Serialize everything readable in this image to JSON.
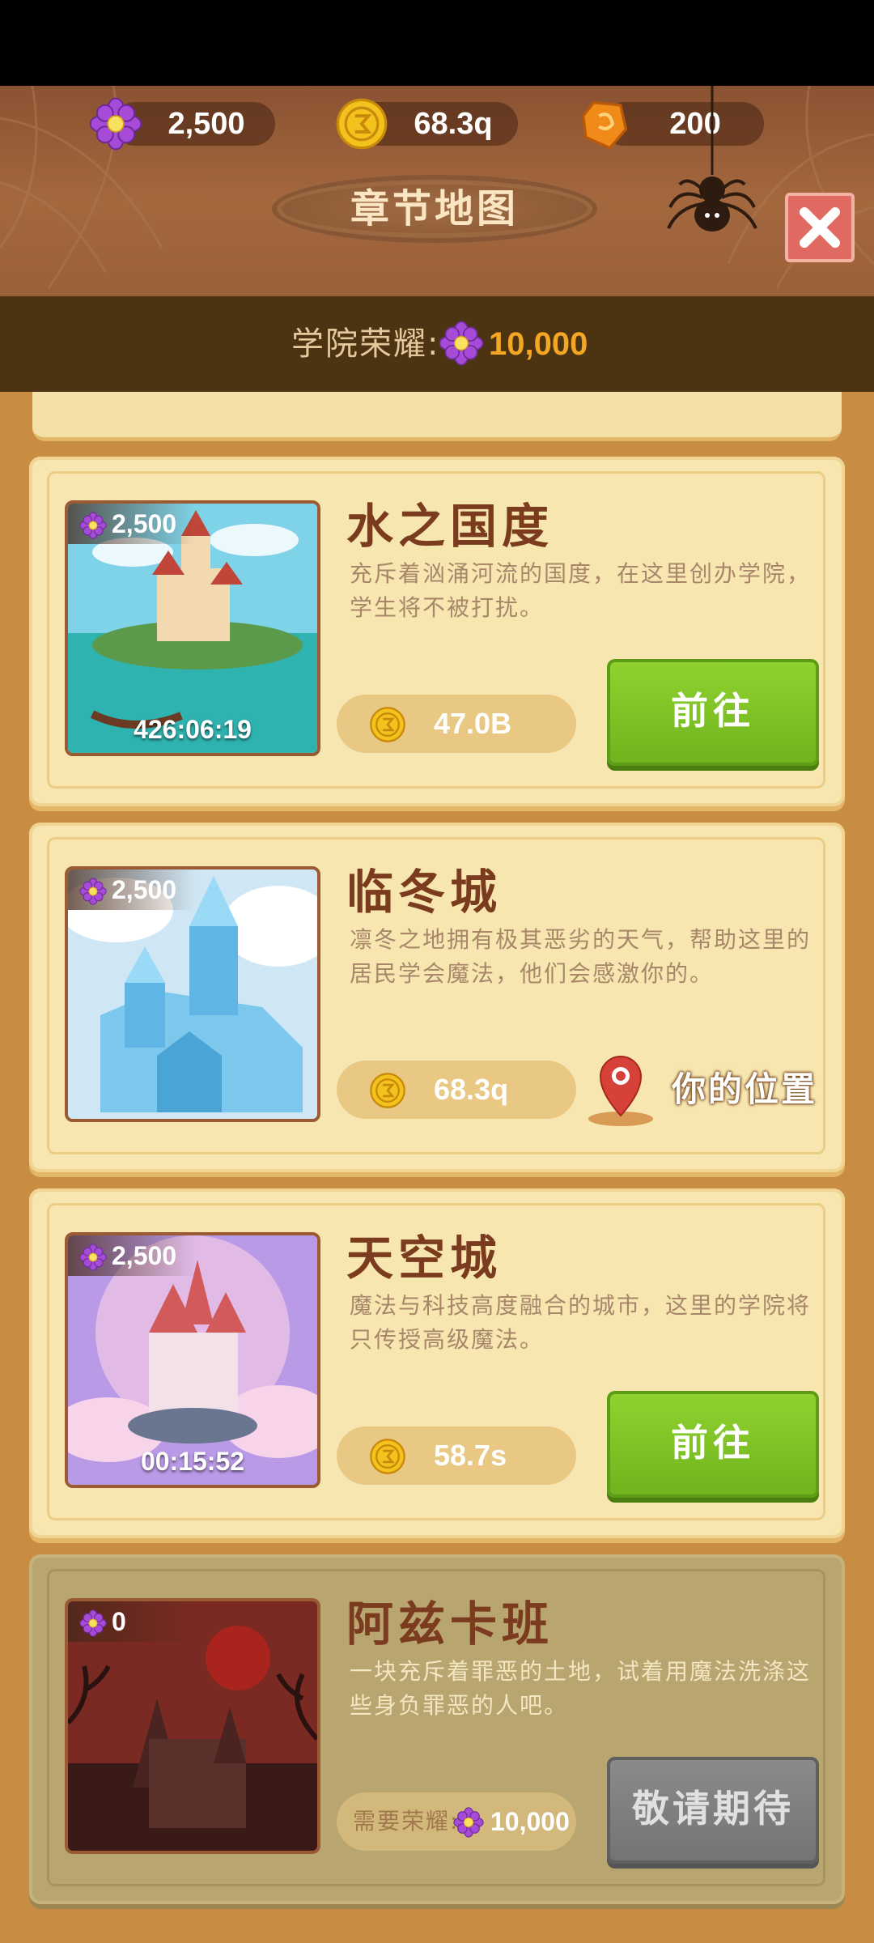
{
  "resources": {
    "honor": {
      "value": "2,500",
      "icon": "purple-flower-icon"
    },
    "gold": {
      "value": "68.3q",
      "icon": "gold-coin-icon"
    },
    "gem": {
      "value": "200",
      "icon": "orange-gem-icon"
    }
  },
  "header": {
    "title": "章节地图",
    "close_icon": "close-icon"
  },
  "academy_honor": {
    "label": "学院荣耀:",
    "value": "10,000"
  },
  "chapters": [
    {
      "name": "水之国度",
      "description": "充斥着汹涌河流的国度，在这里创办学院，学生将不被打扰。",
      "honor": "2,500",
      "timer": "426:06:19",
      "cost": "47.0B",
      "action": "前往"
    },
    {
      "name": "临冬城",
      "description": "凛冬之地拥有极其恶劣的天气，帮助这里的居民学会魔法，他们会感激你的。",
      "honor": "2,500",
      "cost": "68.3q",
      "location_label": "你的位置"
    },
    {
      "name": "天空城",
      "description": "魔法与科技高度融合的城市，这里的学院将只传授高级魔法。",
      "honor": "2,500",
      "timer": "00:15:52",
      "cost": "58.7s",
      "action": "前往"
    },
    {
      "name": "阿兹卡班",
      "description": "一块充斥着罪恶的土地，试着用魔法洗涤这些身负罪恶的人吧。",
      "honor": "0",
      "requirement_label": "需要荣耀:",
      "requirement_value": "10,000",
      "action": "敬请期待"
    }
  ],
  "colors": {
    "go_button": "#7cc226",
    "locked_button": "#7d7d7d",
    "title_brown": "#7a3b1e",
    "honor_gold": "#f5a623"
  }
}
